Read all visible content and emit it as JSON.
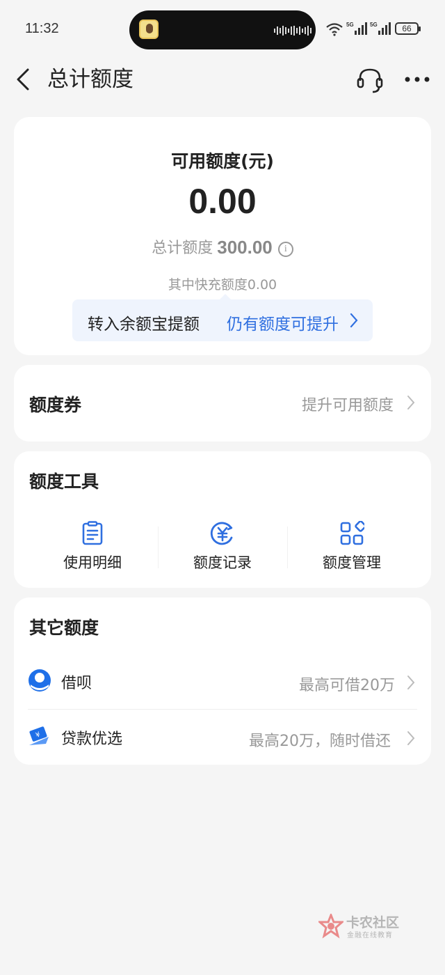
{
  "status_bar": {
    "time": "11:32",
    "battery": "66",
    "network": "5G"
  },
  "header": {
    "title": "总计额度",
    "back_icon": "chevron-left-icon",
    "support_icon": "headset-icon",
    "more_icon": "more-dots-icon"
  },
  "limit_card": {
    "label": "可用额度(元)",
    "value": "0.00",
    "total_label": "总计额度",
    "total_value": "300.00",
    "info_glyph": "i",
    "quick_text": "其中快充额度0.00",
    "upgrade_label": "转入余额宝提额",
    "upgrade_link": "仍有额度可提升"
  },
  "coupon_card": {
    "title": "额度券",
    "action": "提升可用额度"
  },
  "tools_card": {
    "title": "额度工具",
    "items": [
      {
        "label": "使用明细",
        "icon": "document-list-icon"
      },
      {
        "label": "额度记录",
        "icon": "yuan-circle-icon"
      },
      {
        "label": "额度管理",
        "icon": "grid-apps-icon"
      }
    ]
  },
  "other_card": {
    "title": "其它额度",
    "items": [
      {
        "name": "借呗",
        "desc": "最高可借20万",
        "icon": "jiebei-icon"
      },
      {
        "name": "贷款优选",
        "desc": "最高20万，随时借还",
        "icon": "loan-card-icon"
      }
    ]
  },
  "watermark": {
    "name": "卡农社区",
    "sub": "金融在线教育"
  },
  "colors": {
    "accent": "#2f6fe0",
    "background": "#f5f5f5",
    "card": "#ffffff",
    "muted_text": "#999999"
  }
}
